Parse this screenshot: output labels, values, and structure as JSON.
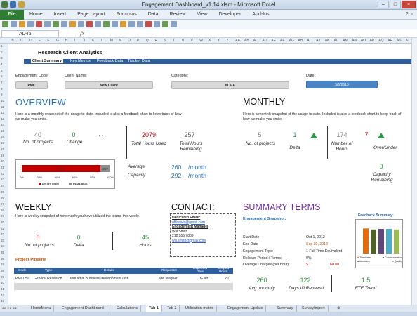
{
  "window": {
    "title": "Engagement Dashboard_v1.14.xlsm - Microsoft Excel",
    "min": "–",
    "max": "□",
    "close": "×"
  },
  "ribbon": {
    "file": "File",
    "tabs": [
      "Home",
      "Insert",
      "Page Layout",
      "Formulas",
      "Data",
      "Review",
      "View",
      "Developer",
      "Add-Ins"
    ]
  },
  "formula_bar": {
    "name_box": "AD46",
    "fx": "fx",
    "value": ""
  },
  "column_headers": [
    "B",
    "C",
    "D",
    "E",
    "F",
    "G",
    "H",
    "I",
    "J",
    "K",
    "L",
    "M",
    "N",
    "O",
    "P",
    "Q",
    "R",
    "S",
    "T",
    "U",
    "V",
    "W",
    "X",
    "Y",
    "Z",
    "AA",
    "AB",
    "AC",
    "AD",
    "AE",
    "AF",
    "AG",
    "AH",
    "AI",
    "AJ",
    "AK",
    "AL",
    "AM",
    "AN",
    "AO",
    "AP",
    "AQ",
    "AR",
    "AS",
    "AT"
  ],
  "row_headers": [
    "1",
    "2",
    "3",
    "4",
    "5",
    "6",
    "7",
    "8",
    "9",
    "10",
    "11",
    "12",
    "13",
    "14",
    "15",
    "16",
    "17",
    "18",
    "19",
    "20",
    "21",
    "22",
    "23",
    "24",
    "25",
    "26",
    "27",
    "28",
    "29",
    "30",
    "31",
    "32",
    "33",
    "34",
    "35",
    "36",
    "37",
    "38",
    "39",
    "40",
    "41",
    "42",
    "43"
  ],
  "header": {
    "brand": "Research Client Analytics",
    "nav": [
      "Client Summary",
      "Key Metrics",
      "Feedback Data",
      "Tracker Data"
    ]
  },
  "engagement": {
    "code_label": "Engagement Code:",
    "code_value": "PMC",
    "client_label": "Client Name:",
    "client_value": "New Client",
    "category_label": "Category:",
    "category_value": "M & A",
    "date_label": "Date:",
    "date_value": "5/5/2013"
  },
  "overview": {
    "title": "OVERVIEW",
    "desc": "Here is a monthly snapshot of the usage to date. Included is also a feedback chart to keep track of how we make you smile.",
    "projects_value": "40",
    "projects_label": "No. of projects",
    "change_value": "0",
    "change_label": "Change",
    "arrows": "↔",
    "total_used_value": "2079",
    "total_used_label": "Total Hours Used",
    "total_remaining_value": "257",
    "total_remaining_label": "Total Hours Remaining",
    "average_label": "Average",
    "average_value": "260",
    "average_unit": "/month",
    "capacity_label": "Capacity",
    "capacity_value": "292",
    "capacity_unit": "/month"
  },
  "chart_data": {
    "type": "bar",
    "categories": [
      "Hours"
    ],
    "series": [
      {
        "name": "HOURS USED",
        "values": [
          89
        ],
        "label": "89%",
        "color": "#c00000"
      },
      {
        "name": "REMAINING",
        "values": [
          11
        ],
        "label": "257",
        "color": "#8c8c8c"
      }
    ],
    "xticks": [
      "0%",
      "20%",
      "40%",
      "60%",
      "80%",
      "100%"
    ],
    "xlim": [
      0,
      100
    ],
    "stacked": true,
    "orientation": "horizontal",
    "legend": "bottom"
  },
  "monthly": {
    "title": "MONTHLY",
    "desc": "Here is a monthly snapshot of the usage to date. Included is also a feedback chart to keep track of how we make you smile.",
    "projects_value": "5",
    "projects_label": "No. of projects",
    "delta_value": "1",
    "delta_label": "Delta",
    "hours_value": "174",
    "hours_label": "Number of Hours",
    "over_value": "7",
    "over_label": "Over/Under",
    "capacity_value": "0",
    "capacity_label": "Capacity Remaining"
  },
  "weekly": {
    "title": "WEEKLY",
    "desc": "Here is weekly snapshot of how much you have utilized the teams this week:",
    "projects_value": "0",
    "projects_label": "No. of projects",
    "delta_value": "0",
    "delta_label": "Delta",
    "hours_value": "45",
    "hours_label": "Hours"
  },
  "contact": {
    "title": "CONTACT:",
    "dedicated_email_label": "Dedicated Email:",
    "dedicated_email": "officewiz@gmail.com",
    "manager_label": "Engagement Manager",
    "manager_name": "Will Smith",
    "phone": "212.555.7889",
    "manager_email": "will.smith@gmail.com"
  },
  "pipeline": {
    "title": "Project Pipeline",
    "columns": [
      "Code",
      "Type",
      "Details",
      "Requestor",
      "Expected Date",
      "Scoped Hours"
    ],
    "rows": [
      [
        "PMC050",
        "General Research",
        "Industrial Business Development List",
        "Joe Wagner",
        "18-Jun",
        "20"
      ]
    ]
  },
  "summary": {
    "title": "SUMMARY TERMS",
    "snapshot_label": "Engagement Snapshot:",
    "rows": [
      {
        "label": "Start Date",
        "value": "Oct 1, 2012"
      },
      {
        "label": "End Date",
        "value": "Sep 30, 2013"
      },
      {
        "label": "Engagement Type:",
        "value": "1 Full Time Equivalent"
      },
      {
        "label": "Rollover Period / Terms:",
        "value": "0%"
      },
      {
        "label": "Overage Charges (per hour)",
        "value": "$",
        "value2": "60.00"
      }
    ],
    "avg_value": "260",
    "avg_label": "Avg. monthly",
    "renewal_value": "122",
    "renewal_label": "Days till Renewal",
    "fte_value": "1.5",
    "fte_label": "FTE Trend"
  },
  "feedback": {
    "title": "Feedback Summary:",
    "legend": [
      "Timeliness",
      "Communication",
      "Accuracy",
      "Quality"
    ],
    "bars": [
      {
        "value": 4.7,
        "color": "#e46c0a"
      },
      {
        "value": 4.5,
        "color": "#4f6228"
      },
      {
        "value": 4.6,
        "color": "#5f497a"
      },
      {
        "value": 4.6,
        "color": "#4bacc6"
      },
      {
        "value": 4.5,
        "color": "#9bbb59"
      }
    ]
  },
  "sheet_tabs": [
    "HomeMenu",
    "Engagement Dashboard",
    "Calculations",
    "Tab 1",
    "Tab 2",
    "Utilization matrix",
    "Engagement Update",
    "Summary",
    "SurveyImport"
  ],
  "sheet_nav": [
    "◂◂",
    "◂",
    "▸",
    "▸▸"
  ],
  "active_sheet": "Tab 1"
}
